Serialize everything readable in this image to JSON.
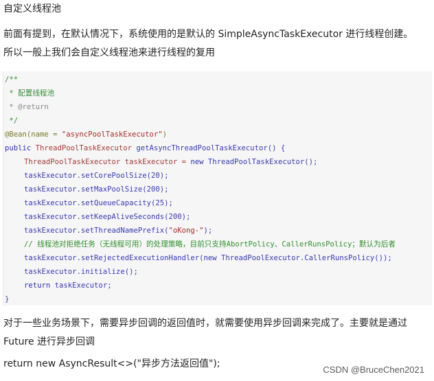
{
  "heading": "自定义线程池",
  "intro": {
    "line1": "前面有提到，在默认情况下，系统使用的是默认的 SimpleAsyncTaskExecutor 进行线程创建。",
    "line2": "所以一般上我们会自定义线程池来进行线程的复用"
  },
  "code": {
    "l1": "/**",
    "l2": " * 配置线程池",
    "l3": " * @return",
    "l4": " */",
    "l5_anno": "@Bean(name = ",
    "l5_str": "\"asyncPoolTaskExecutor\"",
    "l5_end": ")",
    "l6_kw": "public ",
    "l6_type": "ThreadPoolTaskExecutor ",
    "l6_method": "getAsyncThreadPoolTaskExecutor() {",
    "l7_type": "ThreadPoolTaskExecutor ",
    "l7_rest": "taskExecutor = ",
    "l7_kw": "new ",
    "l7_ctor": "ThreadPoolTaskExecutor();",
    "l8": "taskExecutor.setCorePoolSize(20);",
    "l9": "taskExecutor.setMaxPoolSize(200);",
    "l10": "taskExecutor.setQueueCapacity(25);",
    "l11": "taskExecutor.setKeepAliveSeconds(200);",
    "l12_a": "taskExecutor.setThreadNamePrefix(",
    "l12_str": "\"oKong-\"",
    "l12_b": ");",
    "l13": "// 线程池对拒绝任务（无线程可用）的处理策略，目前只支持AbortPolicy、CallerRunsPolicy；默认为后者",
    "l14_a": "taskExecutor.setRejectedExecutionHandler(",
    "l14_kw": "new ",
    "l14_b": "ThreadPoolExecutor.CallerRunsPolicy());",
    "l15": "taskExecutor.initialize();",
    "l16_kw": "return ",
    "l16_b": "taskExecutor;",
    "l17": "}"
  },
  "after": {
    "line1": "对于一些业务场景下，需要异步回调的返回值时，就需要使用异步回调来完成了。主要就是通过",
    "line2": "Future 进行异步回调",
    "line3": "return new AsyncResult<>(\"异步方法返回值\");"
  },
  "watermark": "CSDN @BruceChen2021"
}
